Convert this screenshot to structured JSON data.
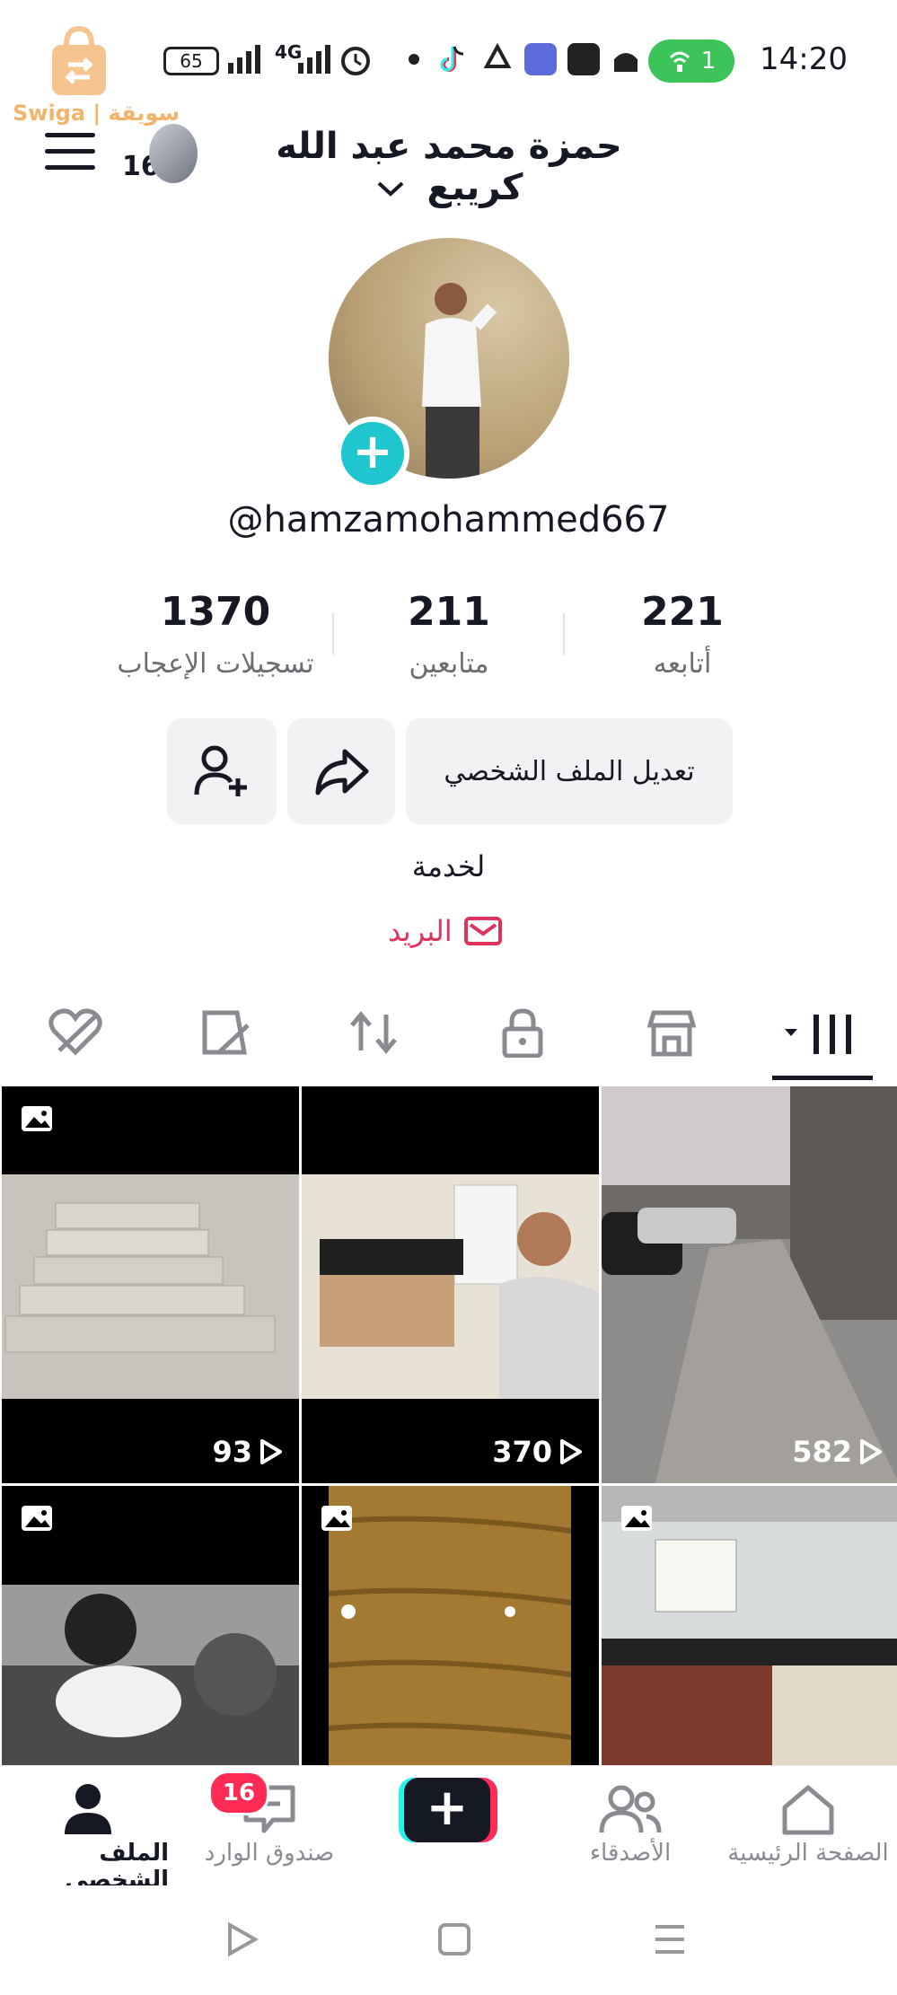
{
  "status_bar": {
    "watermark_text": "Swiga | سويقة",
    "battery": "65",
    "network": "4G",
    "hotspot_count": "1",
    "time": "14:20"
  },
  "header": {
    "account_switch_count": "16",
    "profile_name": "حمزة محمد عبد الله كريبع"
  },
  "profile": {
    "handle": "@hamzamohammed667",
    "stats": {
      "following": {
        "value": "221",
        "label": "أتابعه"
      },
      "followers": {
        "value": "211",
        "label": "متابعين"
      },
      "likes": {
        "value": "1370",
        "label": "تسجيلات الإعجاب"
      }
    },
    "edit_profile_label": "تعديل الملف الشخصي",
    "bio": "لخدمة",
    "email_label": "البريد"
  },
  "videos": [
    {
      "views": "93"
    },
    {
      "views": "370"
    },
    {
      "views": "582"
    },
    {
      "views": ""
    },
    {
      "views": ""
    },
    {
      "views": ""
    }
  ],
  "bottom_nav": {
    "home": "الصفحة الرئيسية",
    "friends": "الأصدقاء",
    "inbox": "صندوق الوارد",
    "inbox_badge": "16",
    "profile": "الملف الشخصي"
  },
  "colors": {
    "accent_pink": "#fe2c55",
    "accent_cyan": "#25f4ee",
    "email_red": "#e0335c",
    "hotspot_green": "#3cc45b"
  }
}
